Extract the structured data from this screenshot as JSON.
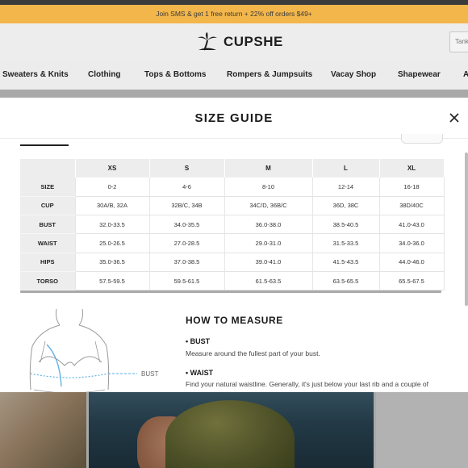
{
  "promo_text": "Join SMS & get 1 free return + 22% off orders $49+",
  "brand": "CUPSHE",
  "search": {
    "placeholder": "Tank"
  },
  "nav": [
    "Sweaters & Knits",
    "Clothing",
    "Tops & Bottoms",
    "Rompers & Jumpsuits",
    "Vacay Shop",
    "Shapewear",
    "A"
  ],
  "modal": {
    "title": "SIZE GUIDE",
    "table": {
      "columns": [
        "",
        "XS",
        "S",
        "M",
        "L",
        "XL"
      ],
      "rows": [
        [
          "SIZE",
          "0-2",
          "4-6",
          "8-10",
          "12-14",
          "16-18"
        ],
        [
          "CUP",
          "30A/B, 32A",
          "32B/C, 34B",
          "34C/D, 36B/C",
          "36D, 38C",
          "38D/40C"
        ],
        [
          "BUST",
          "32.0-33.5",
          "34.0-35.5",
          "36.0-38.0",
          "38.5-40.5",
          "41.0-43.0"
        ],
        [
          "WAIST",
          "25.0-26.5",
          "27.0-28.5",
          "29.0-31.0",
          "31.5-33.5",
          "34.0-36.0"
        ],
        [
          "HIPS",
          "35.0-36.5",
          "37.0-38.5",
          "39.0-41.0",
          "41.5-43.5",
          "44.0-46.0"
        ],
        [
          "TORSO",
          "57.5-59.5",
          "59.5-61.5",
          "61.5-63.5",
          "63.5-65.5",
          "65.5-67.5"
        ]
      ]
    },
    "figure_label": "BUST",
    "how_to_title": "HOW TO MEASURE",
    "bust_title": "• BUST",
    "bust_text": "Measure around the fullest part of your bust.",
    "waist_title": "• WAIST",
    "waist_text": "Find your natural waistline. Generally, it's just below your last rib and a couple of"
  },
  "colors": {
    "promo_bg": "#f3b64b",
    "header_bg": "#ededed",
    "table_header_bg": "#ededed",
    "bust_line": "#5aaee0"
  }
}
